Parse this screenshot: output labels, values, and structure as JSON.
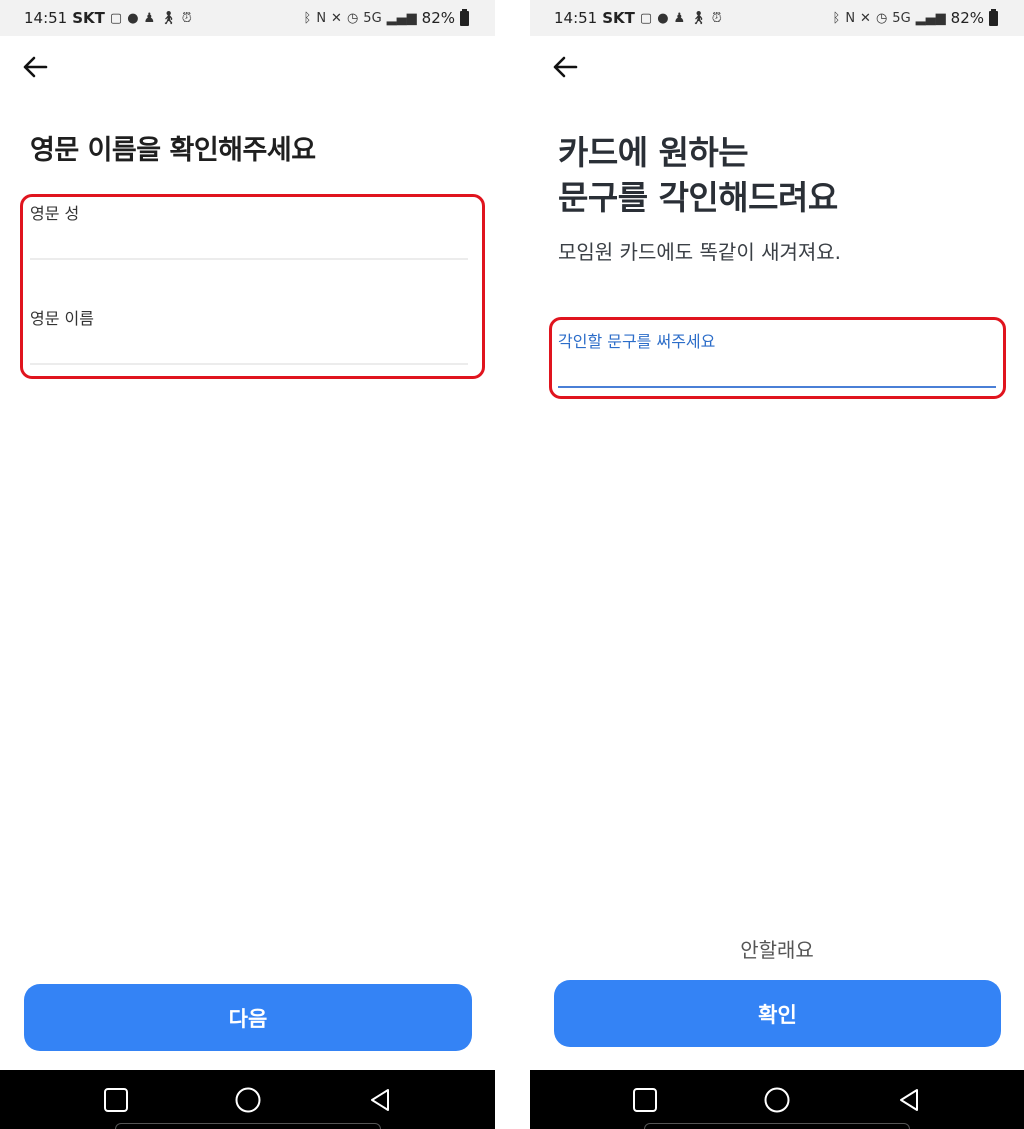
{
  "status_bar": {
    "time": "14:51",
    "carrier": "SKT",
    "network": "5G",
    "battery": "82%"
  },
  "left_screen": {
    "title": "영문 이름을 확인해주세요",
    "last_name": {
      "label": "영문 성",
      "value": ""
    },
    "first_name": {
      "label": "영문 이름",
      "value": ""
    },
    "next_button": "다음"
  },
  "right_screen": {
    "title_line1": "카드에 원하는",
    "title_line2": "문구를 각인해드려요",
    "subtitle": "모임원 카드에도 똑같이 새겨져요.",
    "engraving": {
      "label": "각인할 문구를 써주세요",
      "value": ""
    },
    "skip_link": "안할래요",
    "confirm_button": "확인"
  },
  "colors": {
    "primary": "#3483f5",
    "highlight": "#e0141e",
    "active_label": "#2c6dc9"
  }
}
